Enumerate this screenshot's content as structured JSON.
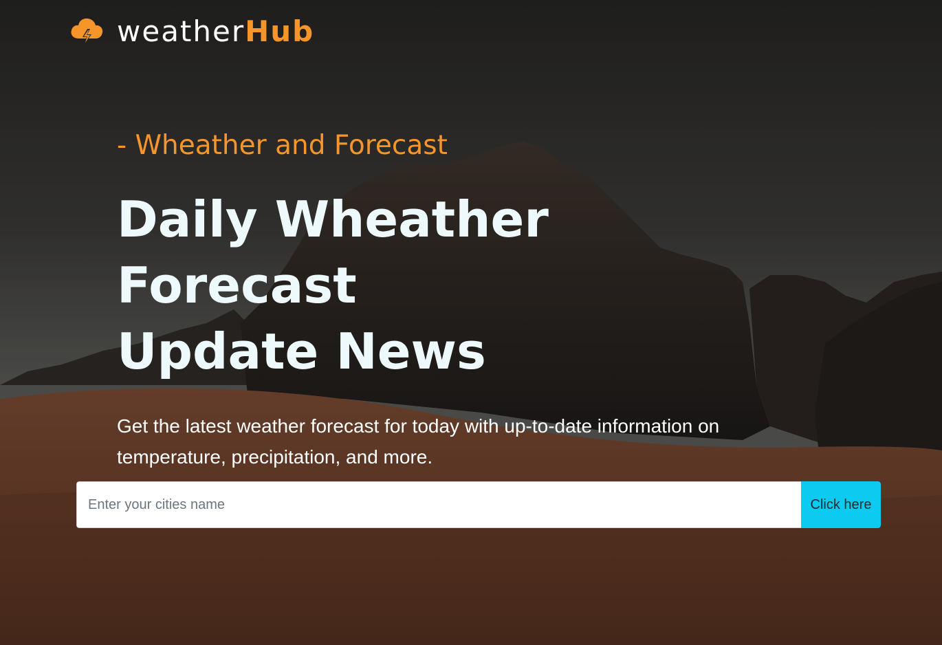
{
  "brand": {
    "name_prefix": "weather",
    "name_accent": "Hub",
    "icon": "cloud-lightning-icon",
    "accent_color": "#f5952a"
  },
  "hero": {
    "eyebrow": "- Wheather and Forecast",
    "headline_line1": "Daily Wheather Forecast",
    "headline_line2": "Update News",
    "lead": "Get the latest weather forecast for today with up-to-date information on temperature, precipitation, and more."
  },
  "search": {
    "placeholder": "Enter your cities name",
    "value": "",
    "button_label": "Click here",
    "button_color": "#0dcaf0"
  },
  "background": {
    "description_icon": "desert-canyon-image"
  }
}
